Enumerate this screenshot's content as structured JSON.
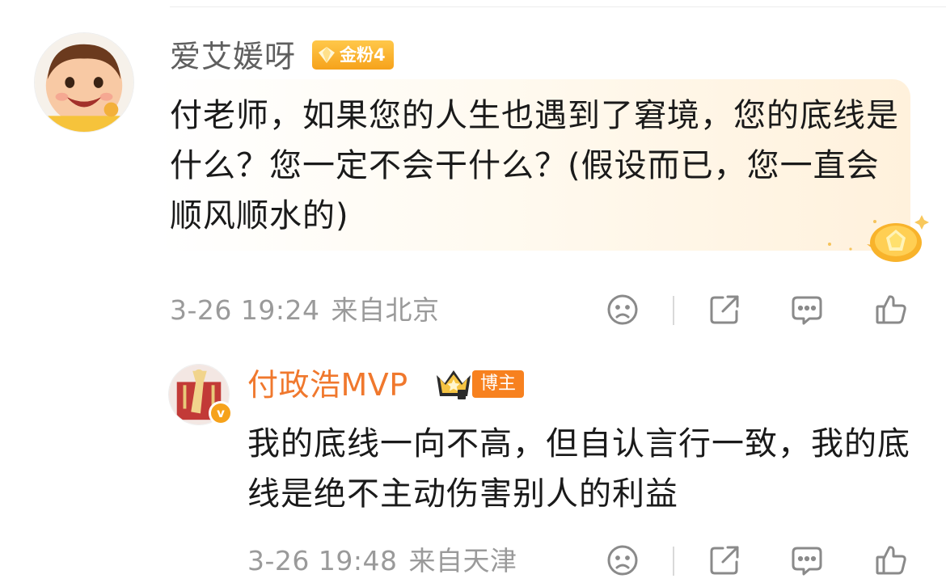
{
  "comment": {
    "username": "爱艾媛呀",
    "fan_badge": "金粉4",
    "text": "付老师，如果您的人生也遇到了窘境，您的底线是什么？您一定不会干什么？(假设而已，您一直会顺风顺水的)",
    "time": "3-26 19:24",
    "location": "来自北京"
  },
  "reply": {
    "username": "付政浩MVP",
    "role_badge": "博主",
    "verified_mark": "v",
    "text": "我的底线一向不高，但自认言行一致，我的底线是绝不主动伤害别人的利益",
    "time": "3-26 19:48",
    "location": "来自天津"
  },
  "icons": {
    "reaction": "sad-face-icon",
    "share": "share-icon",
    "reply": "comment-icon",
    "like": "thumbs-up-icon"
  },
  "colors": {
    "fan_badge": "#f6a21b",
    "blogger_username": "#f0782d",
    "blogger_badge": "#f7811f",
    "meta_text": "#9a9a9a"
  }
}
